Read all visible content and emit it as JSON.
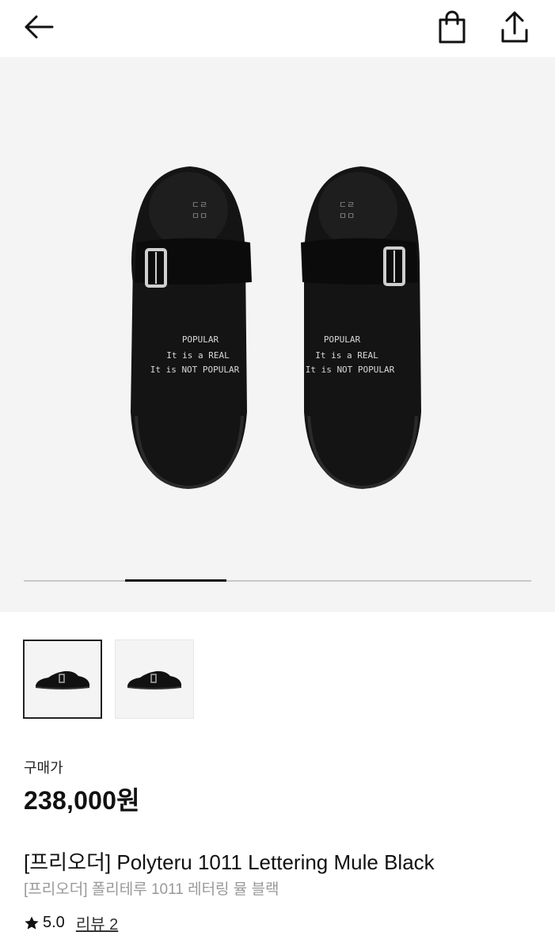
{
  "header": {
    "back_icon": "arrow-left-icon",
    "cart_icon": "shopping-bag-icon",
    "share_icon": "share-icon"
  },
  "hero": {
    "shoe_lettering": [
      "POPULAR",
      "It is a REAL",
      "It is NOT POPULAR"
    ],
    "insole_logo_lines": [
      "ㄷㄹ",
      "ㅁㅁ"
    ],
    "carousel": {
      "current": 2,
      "total": 5
    }
  },
  "thumbnails": [
    {
      "alt": "Mule side view 1",
      "selected": true
    },
    {
      "alt": "Mule side view 2",
      "selected": false
    }
  ],
  "purchase": {
    "price_label": "구매가",
    "price": "238,000원"
  },
  "product": {
    "title_en": "[프리오더] Polyteru 1011 Lettering Mule Black",
    "title_ko": "[프리오더] 폴리테루 1011 레터링 뮬 블랙",
    "rating": "5.0",
    "reviews_label": "리뷰 2"
  },
  "colors": {
    "hero_bg": "#f4f4f4",
    "text_primary": "#111111",
    "text_secondary": "#999999"
  }
}
